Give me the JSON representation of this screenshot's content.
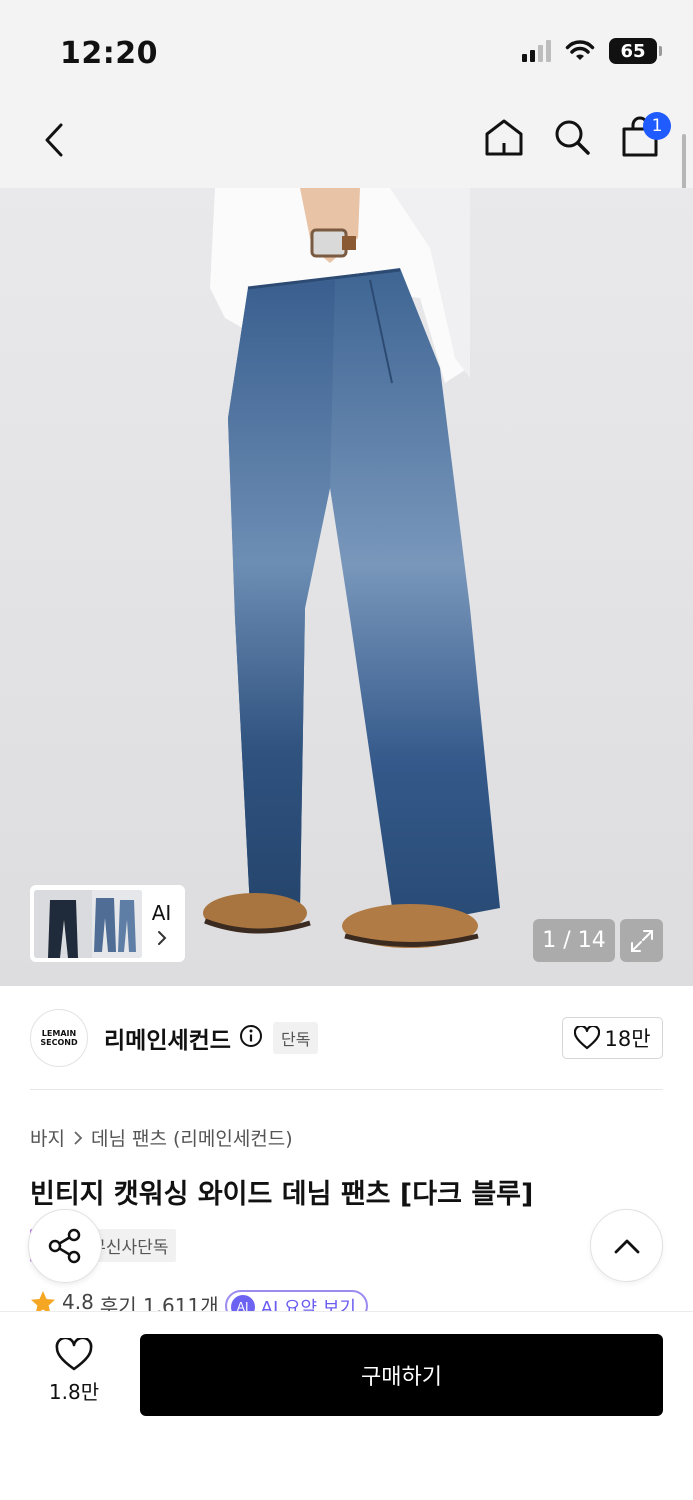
{
  "status_bar": {
    "time": "12:20",
    "battery": "65"
  },
  "header": {
    "cart_count": "1"
  },
  "gallery": {
    "counter": "1 / 14",
    "thumb_label": "AI"
  },
  "brand": {
    "logo_text": "LEMAIN SECOND",
    "name": "리메인세컨드",
    "tag": "단독",
    "likes": "18만"
  },
  "breadcrumb": {
    "category": "바지",
    "subcategory": "데님 팬츠 (리메인세컨드)"
  },
  "product": {
    "title": "빈티지 캣워싱 와이드 데님 팬츠 [다크 블루]",
    "badges": [
      "스타",
      "무신사단독"
    ]
  },
  "reviews": {
    "rating": "4.8",
    "count": "후기 1,611개",
    "ai_summary": "AI 요약 보기",
    "ai_badge": "AI"
  },
  "bottom": {
    "likes": "1.8만",
    "buy_label": "구매하기"
  }
}
